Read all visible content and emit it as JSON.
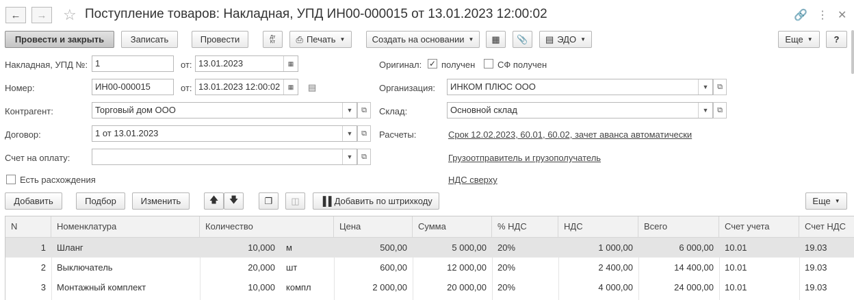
{
  "window": {
    "title": "Поступление товаров: Накладная, УПД ИН00-000015 от 13.01.2023 12:00:02"
  },
  "toolbar": {
    "post_close": "Провести и закрыть",
    "save": "Записать",
    "post": "Провести",
    "dtkt": "Дт\nКт",
    "print": "Печать",
    "create_basis": "Создать на основании",
    "edo": "ЭДО",
    "more": "Еще",
    "help": "?"
  },
  "form": {
    "invoice_label": "Накладная, УПД №:",
    "invoice_value": "1",
    "from_label": "от:",
    "invoice_date": "13.01.2023",
    "number_label": "Номер:",
    "number_value": "ИН00-000015",
    "number_date": "13.01.2023 12:00:02",
    "contractor_label": "Контрагент:",
    "contractor_value": "Торговый дом ООО",
    "contract_label": "Договор:",
    "contract_value": "1 от 13.01.2023",
    "pay_invoice_label": "Счет на оплату:",
    "pay_invoice_value": "",
    "discrepancy_label": "Есть расхождения",
    "original_label": "Оригинал:",
    "received_label": "получен",
    "sf_received_label": "СФ получен",
    "org_label": "Организация:",
    "org_value": "ИНКОМ ПЛЮС ООО",
    "warehouse_label": "Склад:",
    "warehouse_value": "Основной склад",
    "settlements_label": "Расчеты:",
    "settlements_link": "Срок 12.02.2023, 60.01, 60.02, зачет аванса автоматически",
    "shipper_link": "Грузоотправитель и грузополучатель",
    "vat_link": "НДС сверху"
  },
  "table_toolbar": {
    "add": "Добавить",
    "pick": "Подбор",
    "change": "Изменить",
    "add_barcode": "Добавить по штрихкоду",
    "more": "Еще"
  },
  "table": {
    "columns": [
      "N",
      "Номенклатура",
      "Количество",
      "Цена",
      "Сумма",
      "% НДС",
      "НДС",
      "Всего",
      "Счет учета",
      "Счет НДС"
    ],
    "rows": [
      {
        "n": "1",
        "name": "Шланг",
        "qty": "10,000",
        "unit": "м",
        "price": "500,00",
        "sum": "5 000,00",
        "vat_rate": "20%",
        "vat": "1 000,00",
        "total": "6 000,00",
        "account": "10.01",
        "vat_account": "19.03"
      },
      {
        "n": "2",
        "name": "Выключатель",
        "qty": "20,000",
        "unit": "шт",
        "price": "600,00",
        "sum": "12 000,00",
        "vat_rate": "20%",
        "vat": "2 400,00",
        "total": "14 400,00",
        "account": "10.01",
        "vat_account": "19.03"
      },
      {
        "n": "3",
        "name": "Монтажный комплект",
        "qty": "10,000",
        "unit": "компл",
        "price": "2 000,00",
        "sum": "20 000,00",
        "vat_rate": "20%",
        "vat": "4 000,00",
        "total": "24 000,00",
        "account": "10.01",
        "vat_account": "19.03"
      }
    ]
  }
}
